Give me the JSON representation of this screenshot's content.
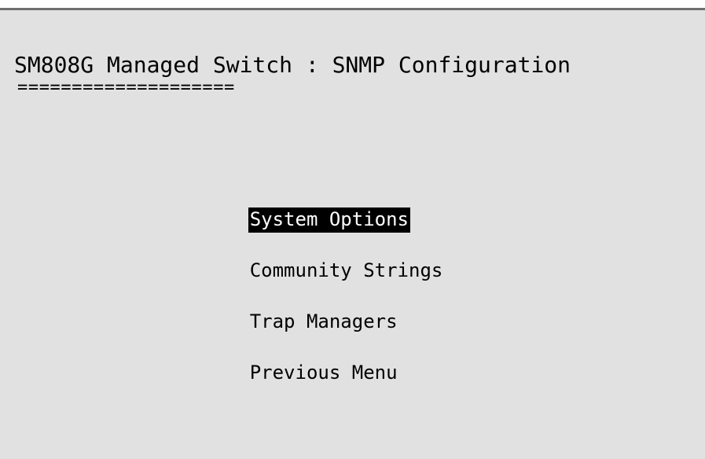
{
  "header": {
    "title": "SM808G Managed Switch : SNMP Configuration",
    "underline": "===================="
  },
  "menu": {
    "selected_index": 0,
    "items": [
      {
        "label": "System Options"
      },
      {
        "label": "Community Strings"
      },
      {
        "label": "Trap Managers"
      },
      {
        "label": "Previous Menu"
      }
    ]
  },
  "colors": {
    "background": "#e1e1e1",
    "text": "#000000",
    "highlight_bg": "#000000",
    "highlight_text": "#ffffff"
  }
}
